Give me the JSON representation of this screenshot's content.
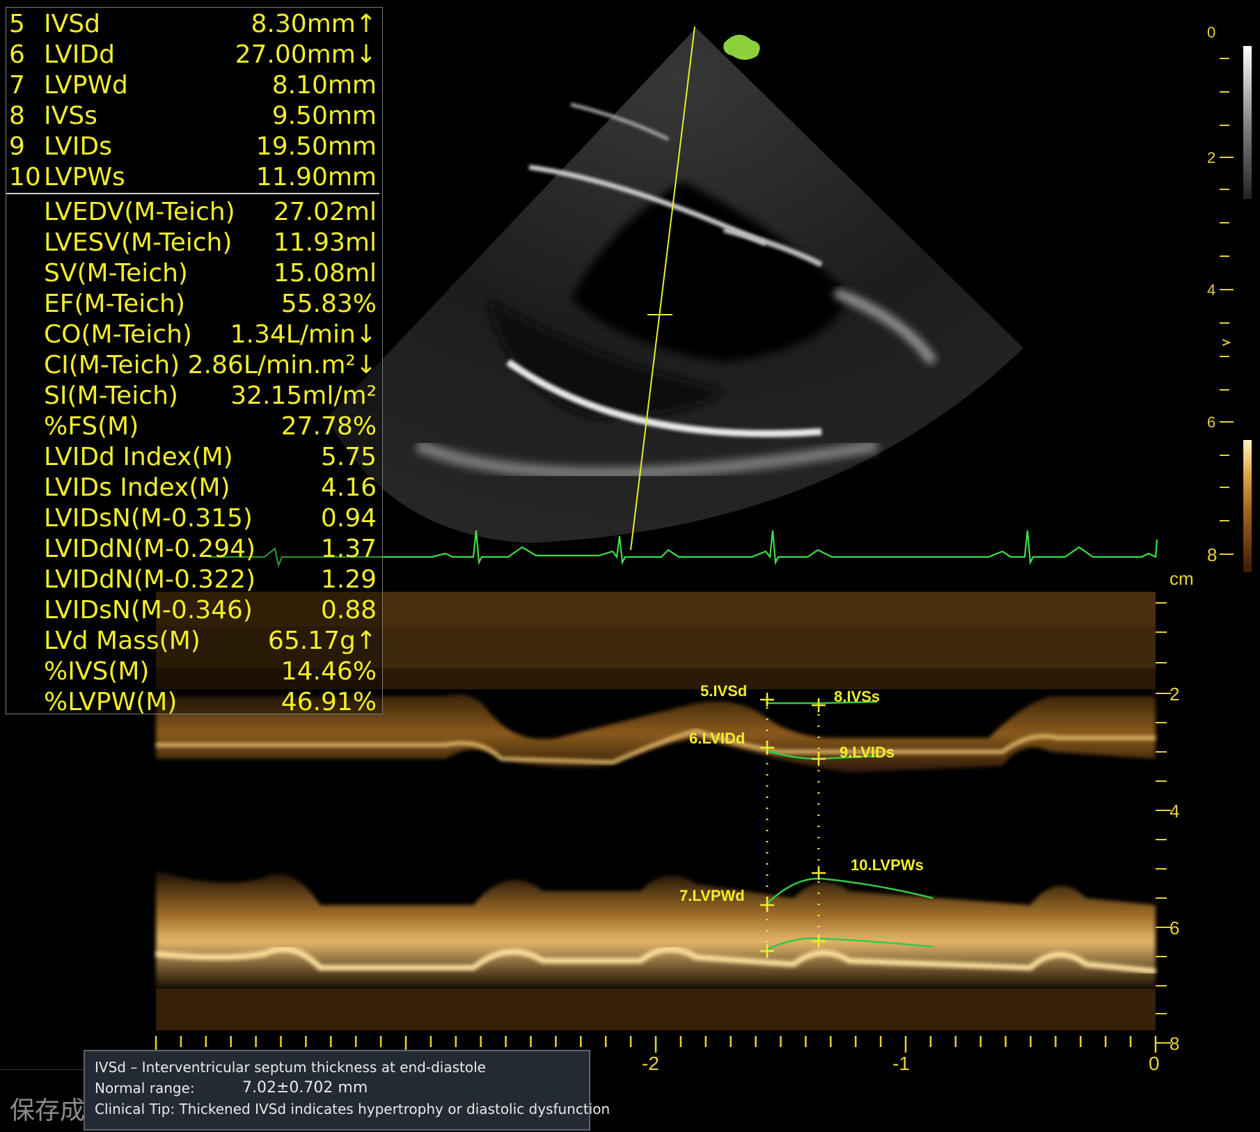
{
  "measurements": {
    "primary": [
      {
        "num": "5",
        "label": "IVSd",
        "value": "8.30mm↑"
      },
      {
        "num": "6",
        "label": "LVIDd",
        "value": "27.00mm↓"
      },
      {
        "num": "7",
        "label": "LVPWd",
        "value": "8.10mm"
      },
      {
        "num": "8",
        "label": "IVSs",
        "value": "9.50mm"
      },
      {
        "num": "9",
        "label": "LVIDs",
        "value": "19.50mm"
      },
      {
        "num": "10",
        "label": "LVPWs",
        "value": "11.90mm"
      }
    ],
    "calculated": [
      {
        "label": "LVEDV(M-Teich)",
        "value": "27.02ml"
      },
      {
        "label": "LVESV(M-Teich)",
        "value": "11.93ml"
      },
      {
        "label": "SV(M-Teich)",
        "value": "15.08ml"
      },
      {
        "label": "EF(M-Teich)",
        "value": "55.83%"
      },
      {
        "label": "CO(M-Teich)",
        "value": "1.34L/min↓"
      },
      {
        "label": "CI(M-Teich)",
        "value": "2.86L/min.m²↓"
      },
      {
        "label": "SI(M-Teich)",
        "value": "32.15ml/m²"
      },
      {
        "label": "%FS(M)",
        "value": "27.78%"
      },
      {
        "label": "LVIDd Index(M)",
        "value": "5.75"
      },
      {
        "label": "LVIDs Index(M)",
        "value": "4.16"
      },
      {
        "label": "LVIDsN(M-0.315)",
        "value": "0.94"
      },
      {
        "label": "LVIDdN(M-0.294)",
        "value": "1.37"
      },
      {
        "label": "LVIDdN(M-0.322)",
        "value": "1.29"
      },
      {
        "label": "LVIDsN(M-0.346)",
        "value": "0.88"
      },
      {
        "label": "LVd Mass(M)",
        "value": "65.17g↑"
      },
      {
        "label": "%IVS(M)",
        "value": "14.46%"
      },
      {
        "label": "%LVPW(M)",
        "value": "46.91%"
      }
    ]
  },
  "depth_scale": {
    "labels": [
      "0",
      "2",
      "4",
      "6",
      "8"
    ],
    "unit": "cm"
  },
  "mmode": {
    "depth_labels": [
      "2",
      "4",
      "6",
      "8"
    ],
    "time_labels": [
      "-2",
      "-1",
      "0"
    ],
    "markers": {
      "ivsd": "5.IVSd",
      "lvidd": "6.LVIDd",
      "lvpwd": "7.LVPWd",
      "ivss": "8.IVSs",
      "lvids": "9.LVIDs",
      "lvpws": "10.LVPWs"
    }
  },
  "tooltip": {
    "title": "IVSd – Interventricular septum thickness at end-diastole",
    "range_label": "Normal range:",
    "range_value": "7.02±0.702 mm",
    "tip": "Clinical Tip: Thickened IVSd indicates hypertrophy or diastolic dysfunction"
  },
  "status": {
    "save_text": "保存成"
  },
  "colors": {
    "measure_text": "#f2ee2a",
    "ecg_trace": "#3ee04a",
    "trace_green": "#35c84a",
    "scale_text": "#e6d23a",
    "probe_marker": "#8cd13a"
  }
}
